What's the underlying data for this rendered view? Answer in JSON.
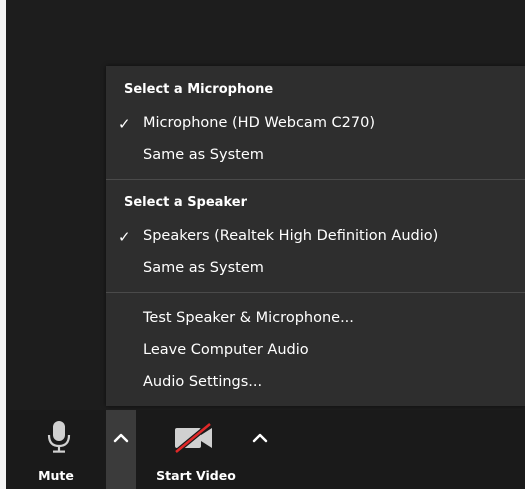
{
  "audio_menu": {
    "microphone_heading": "Select a Microphone",
    "microphones": [
      {
        "label": "Microphone (HD Webcam C270)",
        "checked": true
      },
      {
        "label": "Same as System",
        "checked": false
      }
    ],
    "speaker_heading": "Select a Speaker",
    "speakers": [
      {
        "label": "Speakers (Realtek High Definition Audio)",
        "checked": true
      },
      {
        "label": "Same as System",
        "checked": false
      }
    ],
    "actions": [
      {
        "label": "Test Speaker & Microphone..."
      },
      {
        "label": "Leave Computer Audio"
      },
      {
        "label": "Audio Settings..."
      }
    ],
    "check_glyph": "✓"
  },
  "toolbar": {
    "mute_label": "Mute",
    "start_video_label": "Start Video",
    "icons": {
      "mute": "microphone-icon",
      "caret": "chevron-up-icon",
      "video": "video-off-icon"
    },
    "colors": {
      "video_off_slash": "#e02828",
      "caret_active_bg": "#3b3b3b"
    }
  }
}
